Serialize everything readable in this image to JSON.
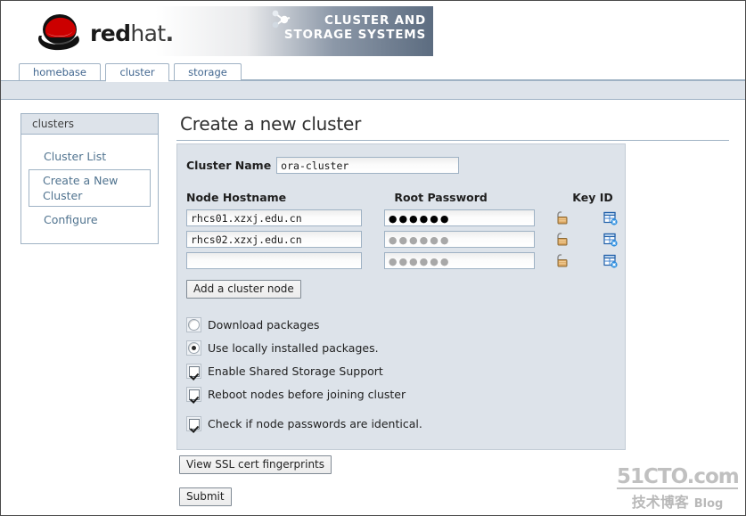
{
  "brand": {
    "wordmark_bold": "red",
    "wordmark_light": "hat",
    "wordmark_dot": ".",
    "product_line1": "CLUSTER AND",
    "product_line2": "STORAGE SYSTEMS"
  },
  "tabs": [
    {
      "label": "homebase",
      "active": false
    },
    {
      "label": "cluster",
      "active": true
    },
    {
      "label": "storage",
      "active": false
    }
  ],
  "sidebar": {
    "header": "clusters",
    "items": [
      {
        "label": "Cluster List",
        "selected": false
      },
      {
        "label": "Create a New\nCluster",
        "selected": true
      },
      {
        "label": "Configure",
        "selected": false
      }
    ],
    "item0": "Cluster List",
    "item1_line1": "Create a New",
    "item1_line2": "Cluster",
    "item2": "Configure"
  },
  "main": {
    "title": "Create a new cluster",
    "cluster_name_label": "Cluster Name",
    "cluster_name_value": "ora-cluster",
    "columns": {
      "hostname": "Node Hostname",
      "password": "Root Password",
      "keyid": "Key ID"
    },
    "nodes": [
      {
        "hostname": "rhcs01.xzxj.edu.cn",
        "password_dots": "●●●●●●",
        "password_filled": true
      },
      {
        "hostname": "rhcs02.xzxj.edu.cn",
        "password_dots": "●●●●●●",
        "password_filled": false
      },
      {
        "hostname": "",
        "password_dots": "●●●●●●",
        "password_filled": false
      }
    ],
    "node_rows": {
      "r0_host": "rhcs01.xzxj.edu.cn",
      "r1_host": "rhcs02.xzxj.edu.cn",
      "r2_host": "",
      "r0_pass": "●●●●●●",
      "r1_pass": "●●●●●●",
      "r2_pass": "●●●●●●"
    },
    "add_node_label": "Add a cluster node",
    "options": {
      "download_packages": "Download packages",
      "use_local_packages": "Use locally installed packages.",
      "enable_shared_storage": "Enable Shared Storage Support",
      "reboot_nodes": "Reboot nodes before joining cluster",
      "check_passwords": "Check if node passwords are identical."
    },
    "ssl_button": "View SSL cert fingerprints",
    "submit_button": "Submit"
  },
  "watermark": {
    "main": "51CTO.com",
    "cn": "技术博客",
    "blog": "Blog"
  },
  "colors": {
    "panel_bg": "#dde3ea",
    "border_blue": "#9fb2c4",
    "link_blue": "#50738f",
    "brand_red": "#cc0000"
  }
}
